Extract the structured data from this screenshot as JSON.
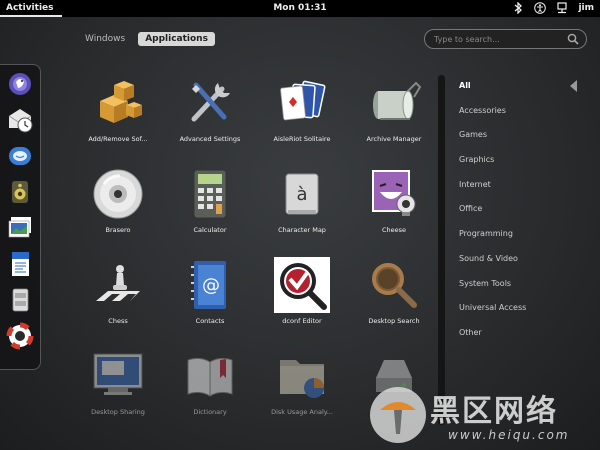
{
  "topbar": {
    "activities": "Activities",
    "clock": "Mon 01:31",
    "user": "jim",
    "tray_icons": [
      "bluetooth-icon",
      "accessibility-icon",
      "network-icon"
    ]
  },
  "view_toggle": {
    "windows": "Windows",
    "applications": "Applications",
    "active": "Applications"
  },
  "search": {
    "placeholder": "Type to search..."
  },
  "dash": {
    "items": [
      "pidgin-icon",
      "mail-clock-icon",
      "empathy-icon",
      "speaker-icon",
      "photos-icon",
      "writer-icon",
      "files-icon",
      "help-lifebuoy-icon"
    ]
  },
  "apps": [
    {
      "label": "Add/Remove Sof...",
      "icon": "package-boxes-icon"
    },
    {
      "label": "Advanced Settings",
      "icon": "tools-icon"
    },
    {
      "label": "AisleRiot Solitaire",
      "icon": "playing-cards-icon"
    },
    {
      "label": "Archive Manager",
      "icon": "archive-roller-icon"
    },
    {
      "label": "Brasero",
      "icon": "disc-icon"
    },
    {
      "label": "Calculator",
      "icon": "calculator-icon"
    },
    {
      "label": "Character Map",
      "icon": "character-map-icon"
    },
    {
      "label": "Cheese",
      "icon": "cheese-webcam-icon"
    },
    {
      "label": "Chess",
      "icon": "chess-icon"
    },
    {
      "label": "Contacts",
      "icon": "contacts-book-icon"
    },
    {
      "label": "dconf Editor",
      "icon": "dconf-editor-icon"
    },
    {
      "label": "Desktop Search",
      "icon": "magnifier-icon"
    },
    {
      "label": "Desktop Sharing",
      "icon": "desktop-sharing-icon"
    },
    {
      "label": "Dictionary",
      "icon": "dictionary-book-icon"
    },
    {
      "label": "Disk Usage Analy...",
      "icon": "disk-usage-folder-icon"
    },
    {
      "label": "",
      "icon": "disks-icon"
    }
  ],
  "categories": {
    "items": [
      "All",
      "Accessories",
      "Games",
      "Graphics",
      "Internet",
      "Office",
      "Programming",
      "Sound & Video",
      "System Tools",
      "Universal Access",
      "Other"
    ],
    "active": "All"
  },
  "watermark": {
    "text": "黑区网络",
    "url": "www.heiqu.com",
    "logo": "mushroom-logo"
  },
  "colors": {
    "topbar": "#000000",
    "background": "#2e3033",
    "active_tab": "#d8d8d8"
  }
}
